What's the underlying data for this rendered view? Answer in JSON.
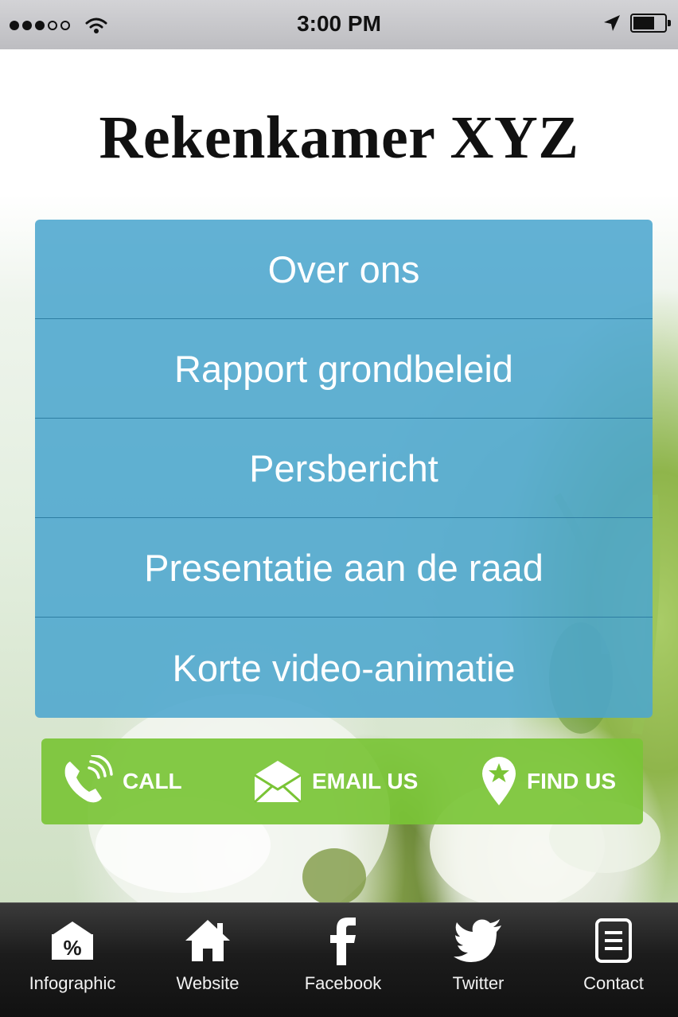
{
  "status_bar": {
    "time": "3:00 PM",
    "signal_icon": "signal-dots-icon",
    "wifi_icon": "wifi-icon",
    "location_icon": "location-arrow-icon",
    "battery_icon": "battery-icon"
  },
  "header": {
    "title": "Rekenkamer XYZ"
  },
  "menu": {
    "items": [
      {
        "label": "Over ons"
      },
      {
        "label": "Rapport grondbeleid"
      },
      {
        "label": "Persbericht"
      },
      {
        "label": "Presentatie aan de raad"
      },
      {
        "label": "Korte video-animatie"
      }
    ],
    "color": "#4ca6ce"
  },
  "actions": {
    "color": "#7ac436",
    "call": {
      "label": "CALL",
      "icon": "phone-icon"
    },
    "email": {
      "label": "EMAIL US",
      "icon": "envelope-icon"
    },
    "find": {
      "label": "FIND US",
      "icon": "map-pin-star-icon"
    }
  },
  "tab_bar": {
    "tabs": [
      {
        "label": "Infographic",
        "icon": "infographic-percent-icon"
      },
      {
        "label": "Website",
        "icon": "home-icon"
      },
      {
        "label": "Facebook",
        "icon": "facebook-icon"
      },
      {
        "label": "Twitter",
        "icon": "twitter-bird-icon"
      },
      {
        "label": "Contact",
        "icon": "contact-card-icon"
      }
    ]
  }
}
